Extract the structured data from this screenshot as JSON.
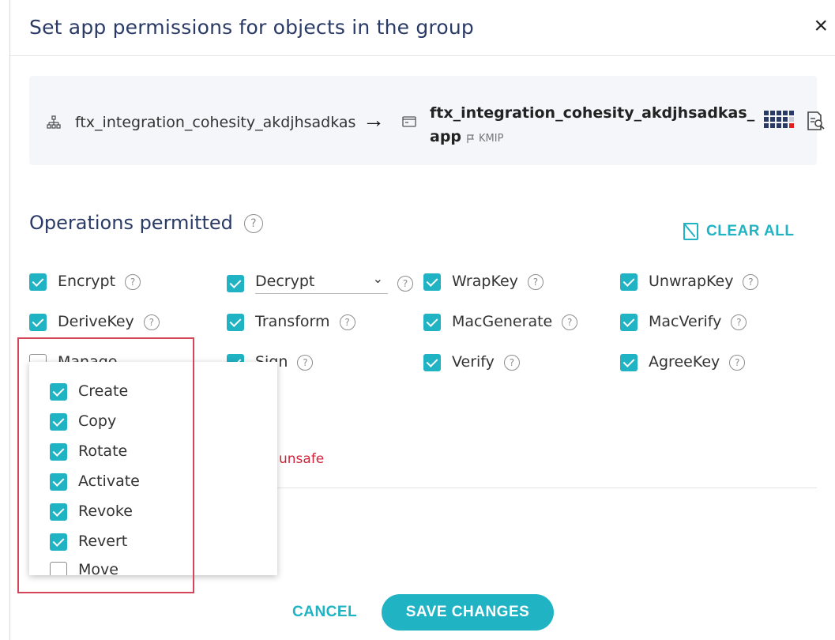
{
  "dialog": {
    "title": "Set app permissions for objects in the group",
    "close_label": "×"
  },
  "mapping": {
    "group_icon": "hierarchy-icon",
    "group_name": "ftx_integration_cohesity_akdjhsadkas",
    "arrow": "→",
    "app_icon": "app-window-icon",
    "app_name_line1": "ftx_integration_cohesity_akdjhsadkas_",
    "app_name_line2": "app",
    "app_type": "KMIP",
    "grid_icon": "grid-icon",
    "report_icon": "report-icon"
  },
  "operations": {
    "title": "Operations permitted",
    "help": "?",
    "clear_all": "CLEAR ALL",
    "items": [
      {
        "label": "Encrypt",
        "checked": true
      },
      {
        "label": "Decrypt",
        "checked": true
      },
      {
        "label": "WrapKey",
        "checked": true
      },
      {
        "label": "UnwrapKey",
        "checked": true
      },
      {
        "label": "DeriveKey",
        "checked": true
      },
      {
        "label": "Transform",
        "checked": true
      },
      {
        "label": "MacGenerate",
        "checked": true
      },
      {
        "label": "MacVerify",
        "checked": true
      },
      {
        "label": "Manage",
        "checked": false
      },
      {
        "label": "Sign",
        "checked": true
      },
      {
        "label": "Verify",
        "checked": true
      },
      {
        "label": "AgreeKey",
        "checked": true
      }
    ],
    "unsafe_text": "unsafe"
  },
  "manage_dropdown": {
    "items": [
      {
        "label": "Create",
        "checked": true
      },
      {
        "label": "Copy",
        "checked": true
      },
      {
        "label": "Rotate",
        "checked": true
      },
      {
        "label": "Activate",
        "checked": true
      },
      {
        "label": "Revoke",
        "checked": true
      },
      {
        "label": "Revert",
        "checked": true
      },
      {
        "label": "Move",
        "checked": false
      }
    ]
  },
  "footer": {
    "cancel": "CANCEL",
    "save": "SAVE CHANGES"
  },
  "colors": {
    "accent": "#1fb3c4",
    "title": "#2a3a66",
    "danger": "#d0243a",
    "highlight": "#d4455a"
  }
}
